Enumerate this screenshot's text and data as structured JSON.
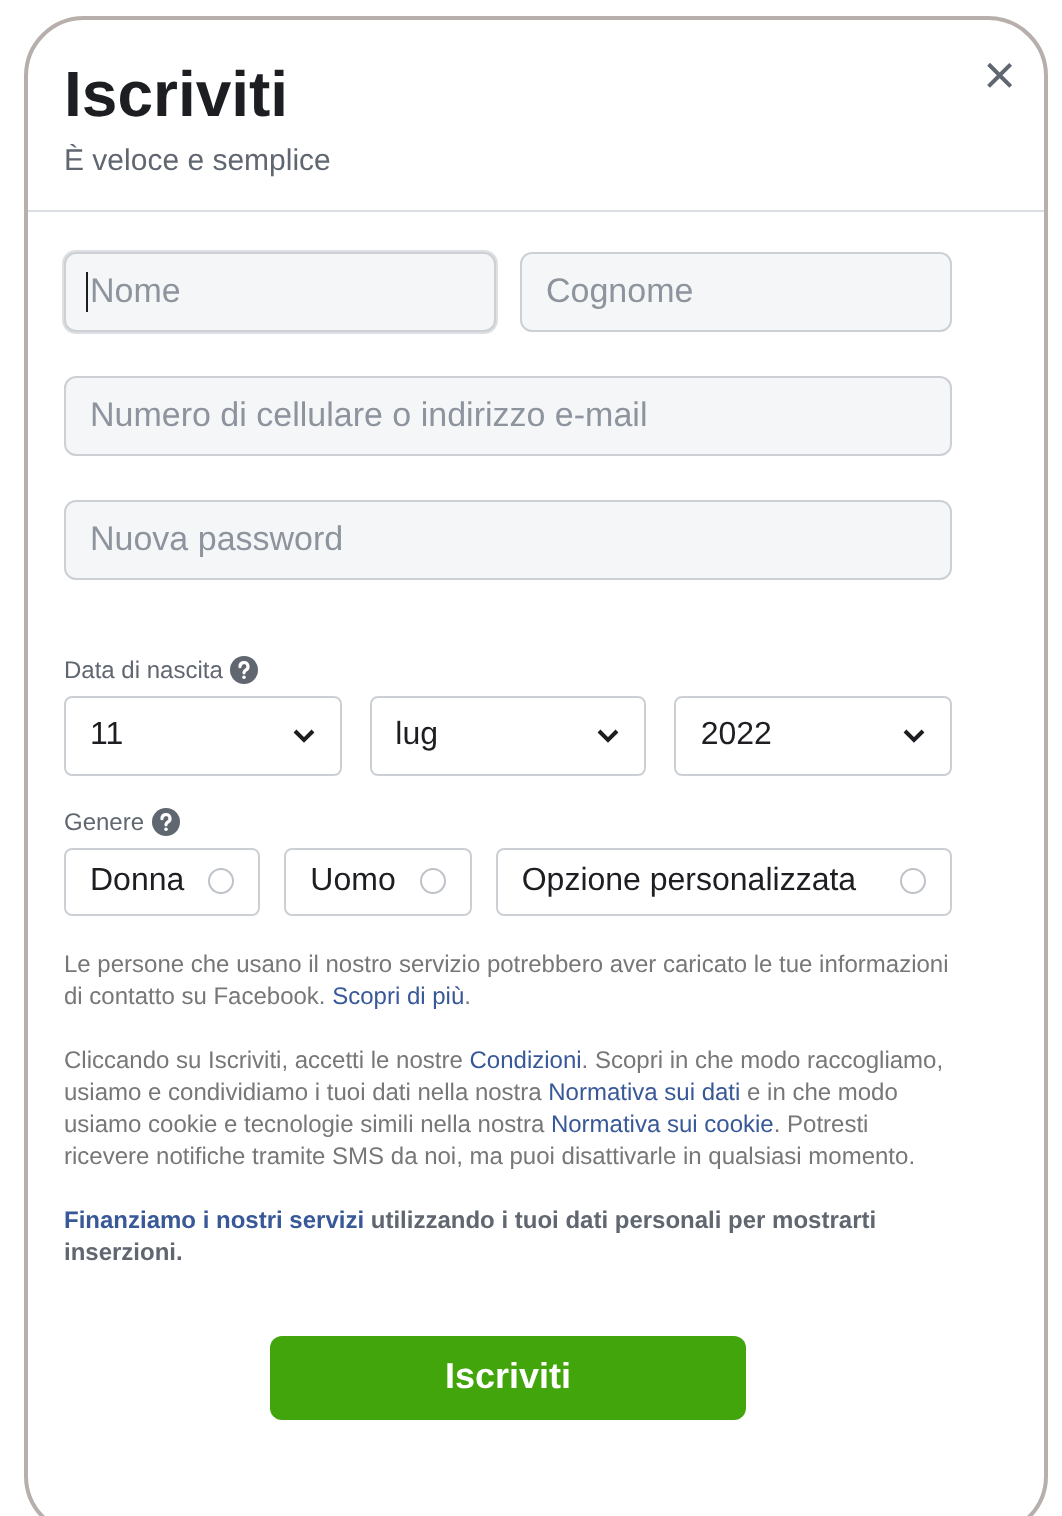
{
  "header": {
    "title": "Iscriviti",
    "subtitle": "È veloce e semplice",
    "close": "×"
  },
  "name_fields": [
    {
      "placeholder": "Nome",
      "focused": true
    },
    {
      "placeholder": "Cognome",
      "focused": false
    }
  ],
  "contact_field": {
    "placeholder": "Numero di cellulare o indirizzo e-mail",
    "focused": false
  },
  "password_field": {
    "placeholder": "Nuova password",
    "focused": false
  },
  "birthdate": {
    "label": "Data di nascita",
    "selects": [
      {
        "value": "11"
      },
      {
        "value": "lug"
      },
      {
        "value": "2022"
      }
    ]
  },
  "gender": {
    "label": "Genere",
    "options": [
      {
        "label": "Donna",
        "selected": false
      },
      {
        "label": "Uomo",
        "selected": false
      },
      {
        "label": "Opzione personalizzata",
        "selected": false
      }
    ]
  },
  "notices": [
    {
      "bold": false,
      "parts": [
        {
          "text": "Le persone che usano il nostro servizio potrebbero aver caricato le tue informazioni di contatto su Facebook. ",
          "link": false
        },
        {
          "text": "Scopri di più",
          "link": true
        },
        {
          "text": ".",
          "link": false
        }
      ]
    },
    {
      "bold": false,
      "parts": [
        {
          "text": "Cliccando su Iscriviti, accetti le nostre ",
          "link": false
        },
        {
          "text": "Condizioni",
          "link": true
        },
        {
          "text": ". Scopri in che modo raccogliamo, usiamo e condividiamo i tuoi dati nella nostra ",
          "link": false
        },
        {
          "text": "Normativa sui dati",
          "link": true
        },
        {
          "text": " e in che modo usiamo cookie e tecnologie simili nella nostra ",
          "link": false
        },
        {
          "text": "Normativa sui cookie",
          "link": true
        },
        {
          "text": ". Potresti ricevere notifiche tramite SMS da noi, ma puoi disattivarle in qualsiasi momento.",
          "link": false
        }
      ]
    },
    {
      "bold": true,
      "parts": [
        {
          "text": "Finanziamo i nostri servizi",
          "link": true
        },
        {
          "text": " utilizzando i tuoi dati personali per mostrarti inserzioni.",
          "link": false
        }
      ]
    }
  ],
  "submit": {
    "label": "Iscriviti"
  }
}
